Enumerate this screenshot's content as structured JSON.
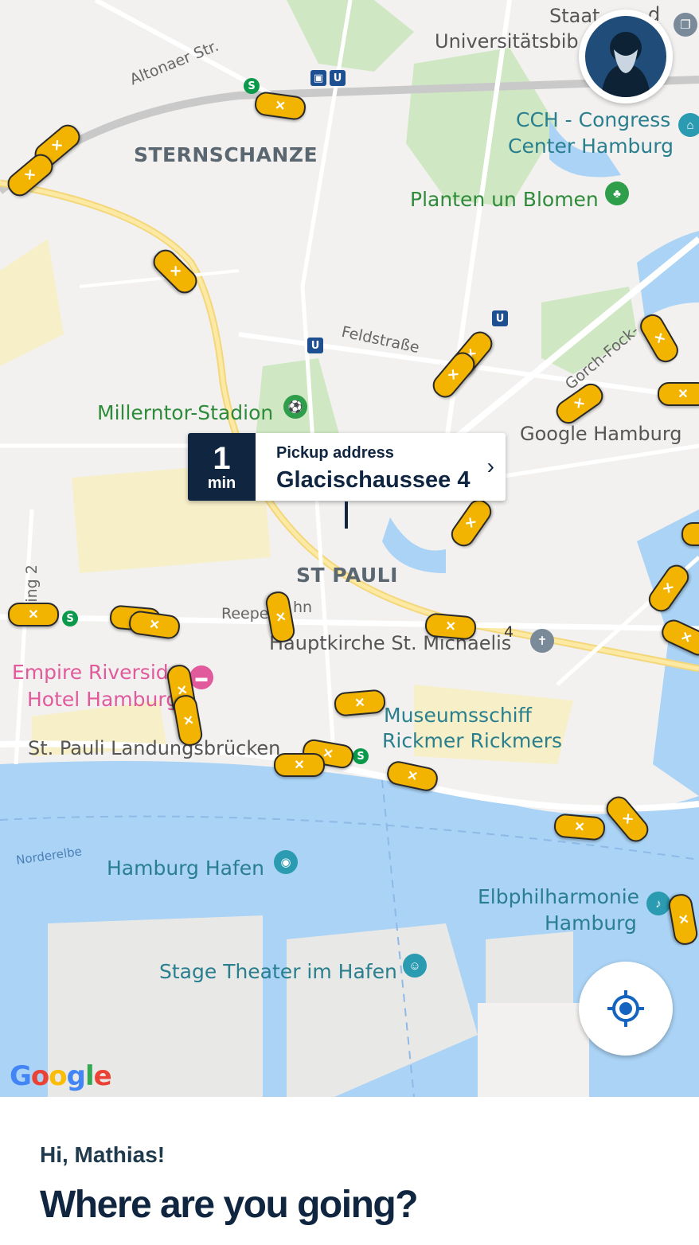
{
  "map": {
    "districts": [
      "STERNSCHANZE",
      "ST PAULI"
    ],
    "roads": [
      "Altonaer Str.",
      "Feldstraße",
      "Gorch-Fock-",
      "Reepe",
      "hn",
      "Ring 2",
      "4"
    ],
    "water_label": "Norderelbe",
    "places_green": [
      "Planten un Blomen",
      "Millerntor-Stadion"
    ],
    "places_teal": [
      "CCH - Congress",
      "Center Hamburg",
      "Hamburg Hafen",
      "Museumsschiff",
      "Rickmer Rickmers",
      "Elbphilharmonie",
      "Hamburg",
      "Stage Theater im Hafen"
    ],
    "places_gray": [
      "Staat",
      "d",
      "Universitätsbib",
      "Google Hamburg",
      "Hauptkirche St. Michaelis",
      "St. Pauli Landungsbrücken"
    ],
    "places_pink": [
      "Empire Riverside",
      "Hotel Hamburg"
    ],
    "logo": "Google"
  },
  "pickup": {
    "eta_value": "1",
    "eta_unit": "min",
    "caption": "Pickup address",
    "street": "Glacischaussee 4"
  },
  "bottom": {
    "greeting": "Hi, Mathias!",
    "question": "Where are you going?"
  },
  "colors": {
    "navy": "#0f2540",
    "taxi": "#f3b400",
    "water": "#aad3f5",
    "accent_blue": "#1565c0"
  }
}
